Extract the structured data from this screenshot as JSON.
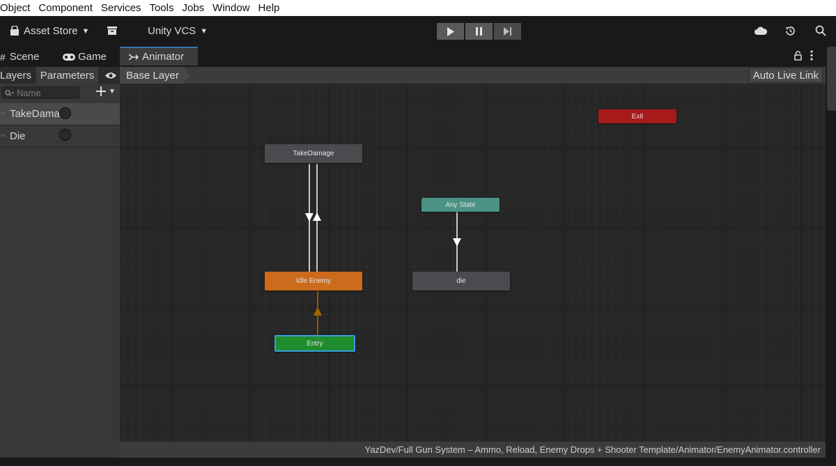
{
  "menubar": [
    "Object",
    "Component",
    "Services",
    "Tools",
    "Jobs",
    "Window",
    "Help"
  ],
  "toolbar": {
    "asset_store": "Asset Store",
    "vcs": "Unity VCS"
  },
  "tabs": {
    "scene": "Scene",
    "game": "Game",
    "animator": "Animator"
  },
  "left_panel": {
    "layers_tab": "Layers",
    "parameters_tab": "Parameters",
    "search_placeholder": "Name",
    "parameters": [
      {
        "name": "TakeDama",
        "type": "trigger",
        "selected": true
      },
      {
        "name": "Die",
        "type": "trigger",
        "selected": false
      }
    ]
  },
  "breadcrumb": {
    "layer": "Base Layer",
    "auto_live_link": "Auto Live Link"
  },
  "graph": {
    "states": {
      "exit": "Exit",
      "take_damage": "TakeDamage",
      "any_state": "Any State",
      "idle_enemy": "Idle Enemy",
      "die": "die",
      "entry": "Entry"
    }
  },
  "colors": {
    "exit": "#a8191b",
    "default_state": "#4b4b4f",
    "any_state": "#4a9384",
    "default_idle": "#cd6b1c",
    "entry": "#1f8c2e",
    "entry_border": "#3aa0e0",
    "transition": "#c8c8c8",
    "entry_transition": "#8a5b00"
  },
  "status": {
    "path": "YazDev/Full Gun System – Ammo, Reload, Enemy Drops + Shooter Template/Animator/EnemyAnimator.controller"
  }
}
